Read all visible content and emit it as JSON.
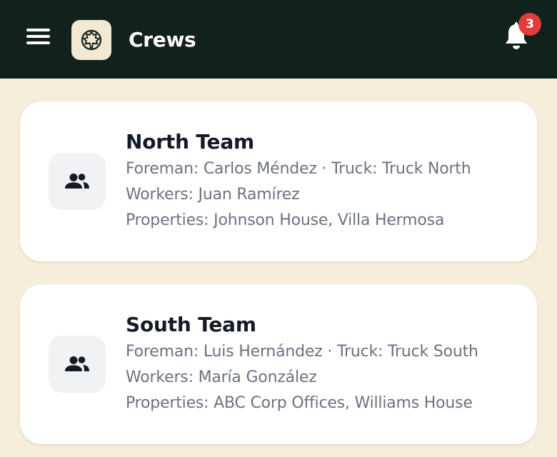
{
  "header": {
    "title": "Crews",
    "notification_count": "3",
    "colors": {
      "bar": "#10221b",
      "badge": "#e23b3b",
      "background": "#f6eeda"
    }
  },
  "crews": [
    {
      "name": "North Team",
      "foreman_line": "Foreman: Carlos Méndez · Truck: Truck North",
      "workers_line": "Workers: Juan Ramírez",
      "properties_line": "Properties: Johnson House, Villa Hermosa"
    },
    {
      "name": "South Team",
      "foreman_line": "Foreman: Luis Hernández · Truck: Truck South",
      "workers_line": "Workers: María González",
      "properties_line": "Properties: ABC Corp Offices, Williams House"
    }
  ],
  "icons": {
    "menu": "menu-icon",
    "logo": "maple-leaf-logo",
    "notifications": "bell-icon",
    "crew": "group-icon"
  }
}
